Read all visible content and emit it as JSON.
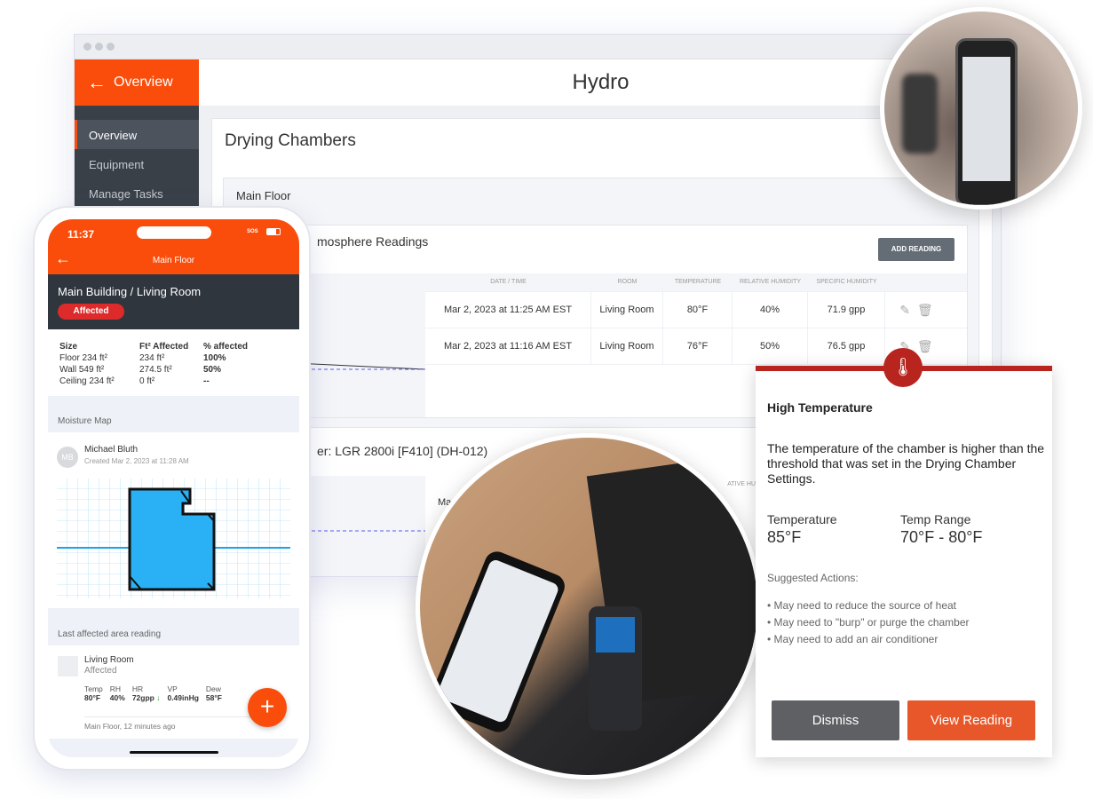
{
  "colors": {
    "accent": "#fa4d0b",
    "sidebar": "#3a4048",
    "alert": "#b8251e",
    "dismiss": "#5f6063",
    "view": "#e8572a"
  },
  "app": {
    "title": "Hydro",
    "back_label": "Overview"
  },
  "sidebar": {
    "items": [
      {
        "label": "Overview",
        "active": true
      },
      {
        "label": "Equipment"
      },
      {
        "label": "Manage Tasks"
      }
    ]
  },
  "main": {
    "title": "Drying Chambers",
    "chamber": "Main Floor",
    "atmosphere": {
      "title": "mosphere Readings",
      "add_label": "ADD READING",
      "headers": [
        "DATE / TIME",
        "Room",
        "TEMPERATURE",
        "RELATIVE HUMIDITY",
        "SPECIFIC HUMIDITY"
      ],
      "rows": [
        [
          "Mar 2, 2023 at 11:25 AM EST",
          "Living Room",
          "80°F",
          "40%",
          "71.9 gpp"
        ],
        [
          "Mar 2, 2023 at 11:16 AM EST",
          "Living Room",
          "76°F",
          "50%",
          "76.5 gpp"
        ]
      ]
    },
    "dehu": {
      "title": "er: LGR 2800i [F410] (DH-012)",
      "header_fragment": "ATIVE HUMIDITY",
      "row_fragment": "Ma"
    }
  },
  "phone": {
    "time": "11:37",
    "status": "SOS",
    "nav_title": "Main Floor",
    "location": "Main Building / Living Room",
    "badge": "Affected",
    "size_headers": [
      "Size",
      "Ft² Affected",
      "% affected"
    ],
    "size_rows": [
      [
        "Floor 234 ft²",
        "234 ft²",
        "100%"
      ],
      [
        "Wall 549 ft²",
        "274.5 ft²",
        "50%"
      ],
      [
        "Ceiling 234 ft²",
        "0 ft²",
        "--"
      ]
    ],
    "moisture_title": "Moisture Map",
    "initials": "MB",
    "author": "Michael Bluth",
    "created": "Created Mar 2, 2023 at 11:28 AM",
    "last_title": "Last affected area reading",
    "room": "Living Room",
    "room_status": "Affected",
    "metrics": [
      {
        "k": "Temp",
        "v": "80°F"
      },
      {
        "k": "RH",
        "v": "40%"
      },
      {
        "k": "HR",
        "v": "72gpp"
      },
      {
        "k": "VP",
        "v": "0.49inHg"
      },
      {
        "k": "Dew",
        "v": "58°F"
      }
    ],
    "footer": "Main Floor, 12 minutes ago"
  },
  "alert": {
    "title": "High Temperature",
    "message": "The temperature of the chamber is higher than the threshold that was set in the Drying Chamber Settings.",
    "temp_label": "Temperature",
    "temp_value": "85°F",
    "range_label": "Temp Range",
    "range_value": "70°F - 80°F",
    "suggested": "Suggested Actions:",
    "actions": [
      "May need to reduce the source of heat",
      "May need to \"burp\" or purge the chamber",
      "May need to add an air conditioner"
    ],
    "dismiss": "Dismiss",
    "view": "View Reading"
  }
}
